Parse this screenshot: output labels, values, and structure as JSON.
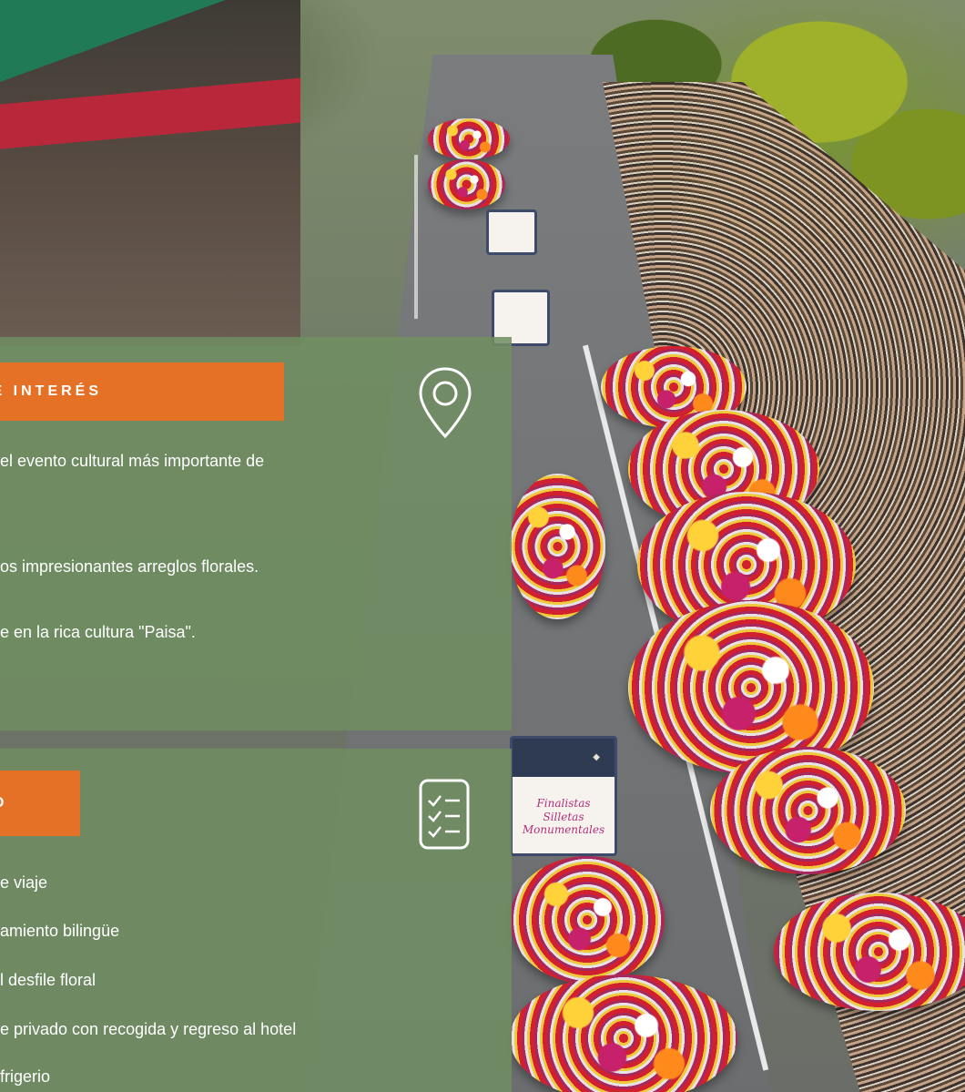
{
  "panel_interest": {
    "tag_label": "DE INTERÉS",
    "icon": "map-pin-icon",
    "lines": [
      "el evento cultural más importante de",
      "os impresionantes arreglos florales.",
      "e en la rica cultura \"Paisa\"."
    ]
  },
  "panel_included": {
    "tag_label": "O",
    "icon": "checklist-icon",
    "items": [
      "e viaje",
      "amiento bilingüe",
      "l desfile floral",
      "e privado con recogida y regreso al hotel",
      "frigerio"
    ]
  },
  "photo": {
    "sign_text": "Finalistas Silletas Monumentales"
  },
  "colors": {
    "accent": "#e57127",
    "panel_overlay": "#708e62",
    "text": "#ffffff"
  }
}
